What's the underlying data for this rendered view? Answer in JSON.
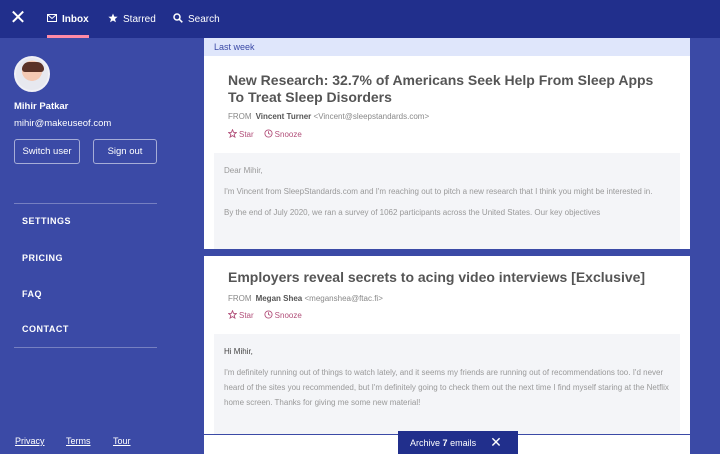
{
  "topbar": {
    "close_glyph": "✕",
    "tabs": [
      {
        "label": "Inbox",
        "icon": "mail-icon"
      },
      {
        "label": "Starred",
        "icon": "star-icon"
      },
      {
        "label": "Search",
        "icon": "search-icon"
      }
    ],
    "active_tab": "Inbox",
    "accent_color": "#ff8aa6"
  },
  "sidebar": {
    "user_name": "Mihir Patkar",
    "user_email": "mihir@makeuseof.com",
    "switch_user": "Switch user",
    "sign_out": "Sign out",
    "nav": [
      "SETTINGS",
      "PRICING",
      "FAQ",
      "CONTACT"
    ],
    "footer": [
      "Privacy",
      "Terms",
      "Tour"
    ]
  },
  "main": {
    "section_label": "Last week",
    "emails": [
      {
        "subject_line1": "New Research: 32.7% of Americans Seek Help From Sleep Apps",
        "subject_line2": "To Treat Sleep Disorders",
        "from_label": "FROM",
        "from_name": "Vincent Turner",
        "from_email": "<Vincent@sleepstandards.com>",
        "star": "Star",
        "snooze": "Snooze",
        "body": [
          "Dear Mihir,",
          "I'm Vincent from SleepStandards.com and I'm reaching out to pitch a new research that I think you might be interested in.",
          "By the end of July 2020, we ran a survey of 1062 participants across the United States. Our key objectives"
        ]
      },
      {
        "subject_line1": "Employers reveal secrets to acing video interviews [Exclusive]",
        "from_label": "FROM",
        "from_name": "Megan Shea",
        "from_email": "<meganshea@ftac.fi>",
        "star": "Star",
        "snooze": "Snooze",
        "body": [
          "Hi Mihir,",
          "I'm definitely running out of things to watch lately, and it seems my friends are running out of recommendations too. I'd never heard of the sites you recommended, but I'm definitely going to check them out the next time I find myself staring at the Netflix home screen. Thanks for giving me some new material!"
        ]
      }
    ]
  },
  "snackbar": {
    "prefix": "Archive",
    "count": "7",
    "suffix": "emails",
    "close_glyph": "✕"
  }
}
